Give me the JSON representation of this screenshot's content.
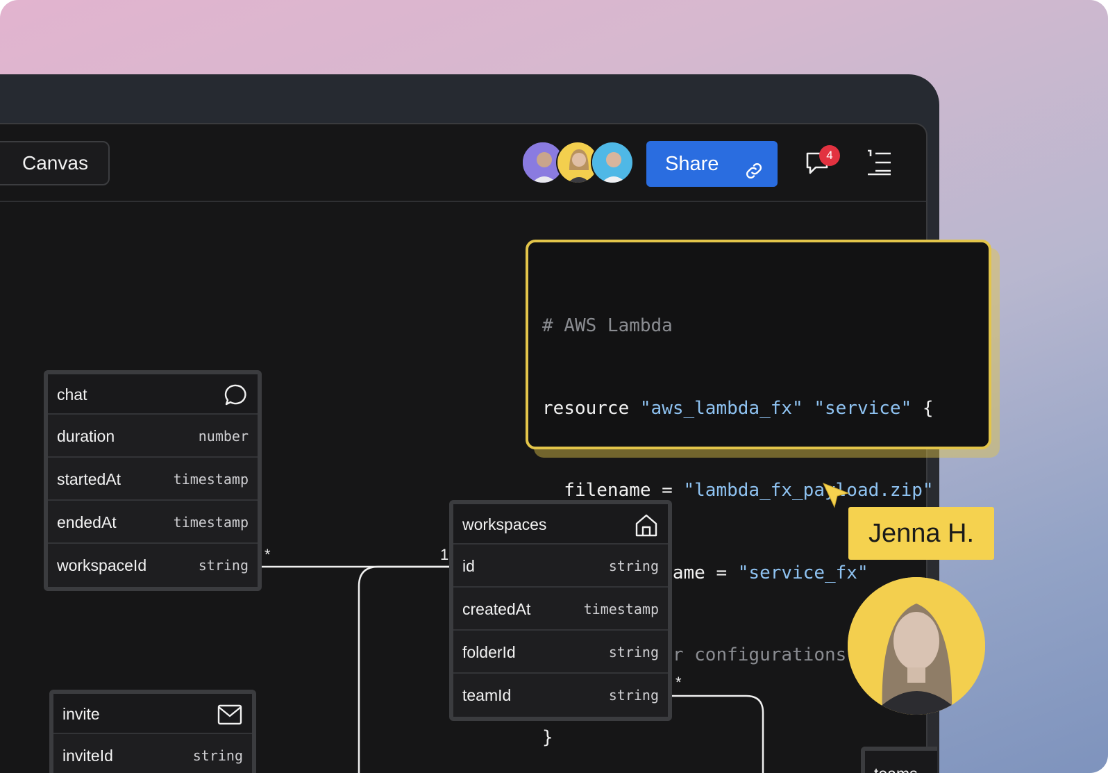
{
  "toolbar": {
    "tab_label": "Canvas",
    "share_label": "Share",
    "notification_count": "4",
    "collaborators": [
      "collaborator-1",
      "collaborator-2",
      "collaborator-3"
    ]
  },
  "code_block": {
    "lines": [
      {
        "text": "# AWS Lambda",
        "kind": "comment"
      },
      {
        "text": "resource \"aws_lambda_fx\" \"service\" {"
      },
      {
        "text": "  filename = \"lambda_fx_payload.zip\""
      },
      {
        "text": "  function_name = \"service_fx\""
      },
      {
        "text": "  # ... other configurations ...",
        "kind": "comment"
      },
      {
        "text": "}"
      }
    ]
  },
  "tables": {
    "chat": {
      "name": "chat",
      "icon": "speech-bubble-icon",
      "fields": [
        {
          "name": "duration",
          "type": "number"
        },
        {
          "name": "startedAt",
          "type": "timestamp"
        },
        {
          "name": "endedAt",
          "type": "timestamp"
        },
        {
          "name": "workspaceId",
          "type": "string"
        }
      ]
    },
    "workspaces": {
      "name": "workspaces",
      "icon": "home-icon",
      "fields": [
        {
          "name": "id",
          "type": "string"
        },
        {
          "name": "createdAt",
          "type": "timestamp"
        },
        {
          "name": "folderId",
          "type": "string"
        },
        {
          "name": "teamId",
          "type": "string"
        }
      ]
    },
    "invite": {
      "name": "invite",
      "icon": "mail-icon",
      "fields": [
        {
          "name": "inviteId",
          "type": "string"
        }
      ]
    },
    "teams": {
      "name": "teams"
    }
  },
  "relations": {
    "chat_many": "*",
    "workspace_one": "1 1",
    "team_many": "*"
  },
  "collaborator_cursor": {
    "name": "Jenna H."
  },
  "colors": {
    "accent": "#2a6de0",
    "highlight": "#f5d24f",
    "badge": "#e23240"
  }
}
